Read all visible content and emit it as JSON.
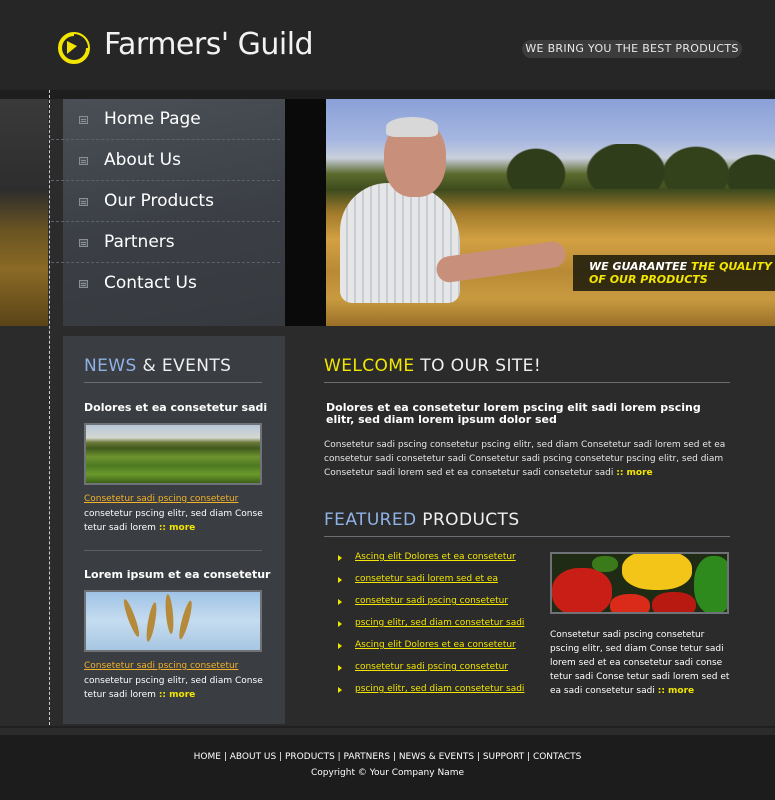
{
  "header": {
    "brand": "Farmers' Guild",
    "tagline": "WE BRING YOU THE BEST PRODUCTS"
  },
  "nav": [
    {
      "label": "Home Page"
    },
    {
      "label": "About Us"
    },
    {
      "label": "Our Products"
    },
    {
      "label": "Partners"
    },
    {
      "label": "Contact Us"
    }
  ],
  "banner": {
    "guarantee_white_1": "WE GUARANTEE ",
    "guarantee_yellow_1": "THE QUALITY",
    "guarantee_yellow_2": "OF OUR PRODUCTS"
  },
  "news": {
    "title_hl": "NEWS",
    "title_rest": " & EVENTS",
    "items": [
      {
        "heading": "Dolores et ea consetetur sadi",
        "link": "Consetetur sadi pscing consetetur ",
        "body": "consetetur pscing elitr, sed diam Conse tetur sadi lorem ",
        "more": ":: more"
      },
      {
        "heading": "Lorem ipsum et ea consetetur",
        "link": "Consetetur sadi pscing consetetur ",
        "body": "consetetur pscing elitr, sed diam Conse tetur sadi lorem ",
        "more": ":: more"
      }
    ]
  },
  "welcome": {
    "title_hl": "WELCOME",
    "title_rest": " TO OUR SITE!",
    "bold": "Dolores et ea consetetur lorem pscing elit sadi lorem pscing elitr, sed diam lorem ipsum dolor sed",
    "body": "Consetetur sadi pscing consetetur pscing elitr, sed diam Consetetur sadi lorem sed  et ea consetetur sadi consetetur sadi Consetetur sadi pscing consetetur pscing elitr, sed diam Consetetur sadi lorem sed  et ea consetetur sadi consetetur sadi ",
    "more": ":: more"
  },
  "featured": {
    "title_hl": "FEATURED",
    "title_rest": " PRODUCTS",
    "links": [
      "Ascing elit Dolores et ea consetetur",
      "consetetur sadi lorem sed  et ea",
      "consetetur sadi pscing consetetur",
      "pscing elitr, sed diam consetetur sadi",
      "Ascing elit Dolores et ea consetetur",
      "consetetur sadi pscing consetetur",
      "pscing elitr, sed diam consetetur sadi"
    ],
    "body": "Consetetur sadi pscing consetetur pscing elitr, sed diam Conse tetur sadi lorem sed  et ea consetetur sadi conse tetur sadi Conse tetur sadi lorem sed  et ea sadi consetetur sadi ",
    "more": ":: more"
  },
  "footer": {
    "links": [
      "HOME",
      "ABOUT US",
      "PRODUCTS",
      "PARTNERS ",
      "NEWS & EVENTS",
      "SUPPORT",
      "CONTACTS"
    ],
    "copyright": "Copyright © Your Company Name"
  },
  "colors": {
    "accent_yellow": "#f2e600",
    "accent_blue": "#8fb2e6",
    "link_orange": "#f2b32a",
    "background": "#2b2b2b"
  }
}
